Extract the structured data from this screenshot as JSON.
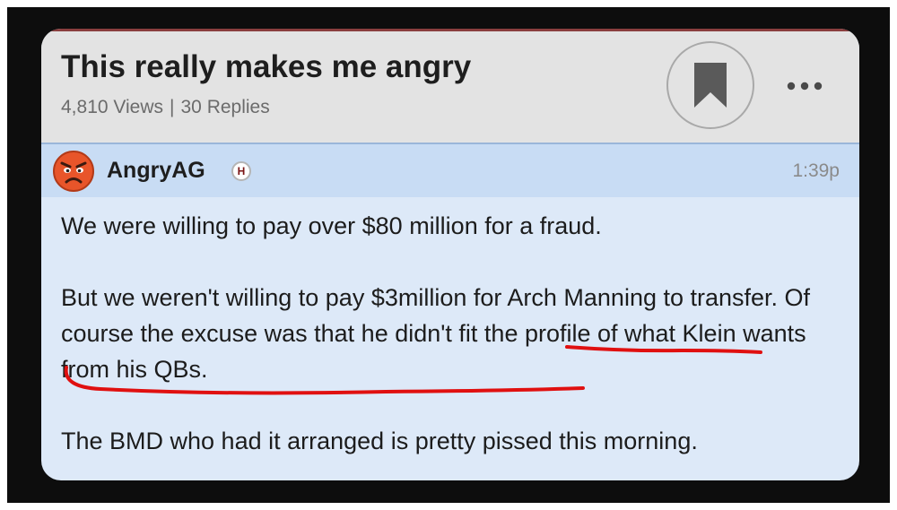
{
  "thread": {
    "title": "This really makes me angry",
    "views": "4,810 Views",
    "replies": "30 Replies",
    "stats_separator": "|"
  },
  "post": {
    "author": "AngryAG",
    "badge": "H",
    "time": "1:39p",
    "paragraphs": [
      "We were willing to pay over $80 million for a fraud.",
      "But we weren't willing to pay $3million for Arch Manning to transfer. Of course the excuse was that he didn't fit the profile of what Klein wants from his QBs.",
      "The BMD who had it arranged is pretty pissed this morning."
    ]
  },
  "icons": {
    "bookmark": "bookmark-icon",
    "more": "more-options-icon",
    "avatar": "angry-face-avatar"
  },
  "colors": {
    "header_bg": "#e3e3e3",
    "post_header_bg": "#c8dcf4",
    "post_body_bg": "#dde9f8",
    "annotation_red": "#e01010",
    "badge_text": "#7a1515"
  }
}
